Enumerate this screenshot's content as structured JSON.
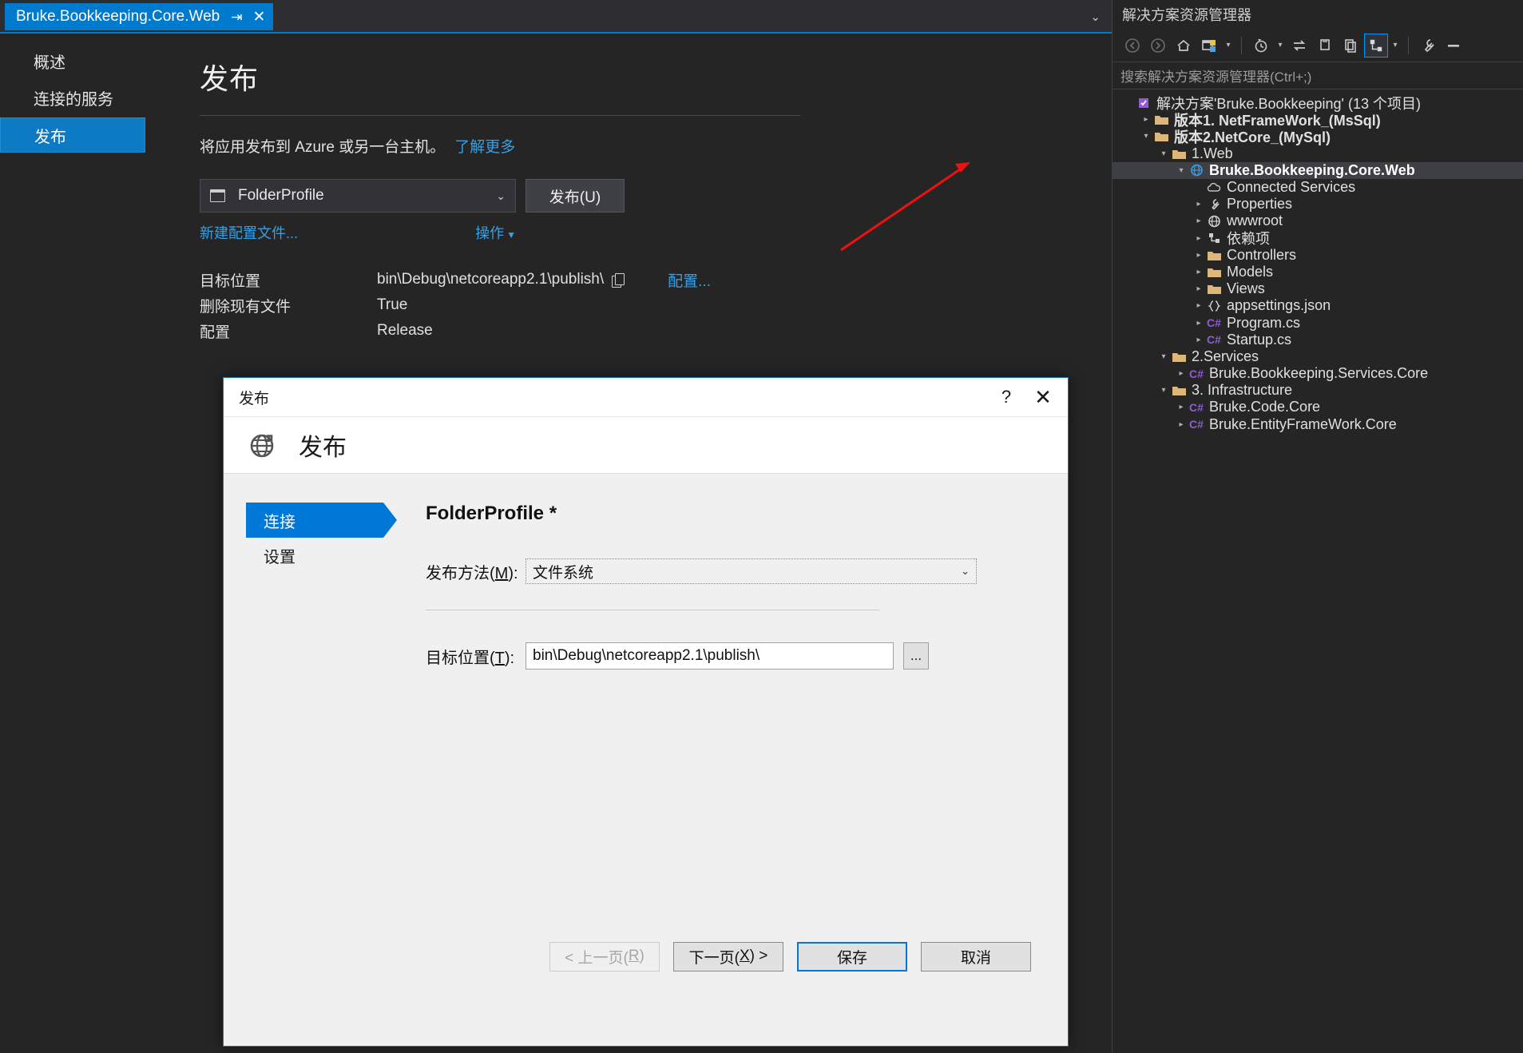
{
  "tab": {
    "title": "Bruke.Bookkeeping.Core.Web",
    "pin_icon": "⇥",
    "close_icon": "✕",
    "overflow_icon": "⌄"
  },
  "leftnav": {
    "items": [
      {
        "label": "概述",
        "selected": false
      },
      {
        "label": "连接的服务",
        "selected": false
      },
      {
        "label": "发布",
        "selected": true
      }
    ]
  },
  "publish_page": {
    "title": "发布",
    "description": "将应用发布到 Azure 或另一台主机。",
    "learn_more": "了解更多",
    "profile_name": "FolderProfile",
    "profile_caret": "⌄",
    "publish_button": "发布(U)",
    "new_profile_link": "新建配置文件...",
    "actions_link": "操作",
    "actions_caret": "▼",
    "details": [
      {
        "key": "目标位置",
        "value": "bin\\Debug\\netcoreapp2.1\\publish\\",
        "has_copy": true,
        "action": "配置..."
      },
      {
        "key": "删除现有文件",
        "value": "True",
        "has_copy": false,
        "action": ""
      },
      {
        "key": "配置",
        "value": "Release",
        "has_copy": false,
        "action": ""
      }
    ]
  },
  "dialog": {
    "titlebar_title": "发布",
    "help_icon": "?",
    "close_icon": "✕",
    "header_title": "发布",
    "header_icon": "globe-publish-icon",
    "nav": [
      {
        "label": "连接",
        "active": true
      },
      {
        "label": "设置",
        "active": false
      }
    ],
    "profile_title": "FolderProfile *",
    "method_label_pre": "发布方法(",
    "method_label_key": "M",
    "method_label_post": "):",
    "method_value": "文件系统",
    "method_caret": "⌄",
    "target_label_pre": "目标位置(",
    "target_label_key": "T",
    "target_label_post": "):",
    "target_value": "bin\\Debug\\netcoreapp2.1\\publish\\",
    "browse_label": "...",
    "buttons": {
      "prev_pre": "< 上一页(",
      "prev_key": "R",
      "prev_post": ")",
      "next_pre": "下一页(",
      "next_key": "X",
      "next_post": ") >",
      "save": "保存",
      "cancel": "取消"
    }
  },
  "solution_explorer": {
    "title": "解决方案资源管理器",
    "search_placeholder": "搜索解决方案资源管理器(Ctrl+;)",
    "toolbar": [
      {
        "name": "back-icon",
        "glyph": "◄",
        "dim": true
      },
      {
        "name": "forward-icon",
        "glyph": "►",
        "dim": true
      },
      {
        "name": "home-icon",
        "glyph": "⌂",
        "dim": false
      },
      {
        "name": "solution-views-icon",
        "glyph": "▤",
        "dim": false
      },
      {
        "name": "pending-changes-icon",
        "glyph": "◷",
        "dim": false
      },
      {
        "name": "sync-with-active-document-icon",
        "glyph": "⇆",
        "dim": false
      },
      {
        "name": "refresh-icon",
        "glyph": "❐",
        "dim": false
      },
      {
        "name": "collapse-all-icon",
        "glyph": "❏",
        "dim": false
      },
      {
        "name": "show-all-files-icon",
        "glyph": "⊿",
        "dim": false
      },
      {
        "name": "properties-icon",
        "glyph": "🔧",
        "dim": false
      },
      {
        "name": "preview-selected-items-icon",
        "glyph": "▬",
        "dim": false
      }
    ],
    "tree": [
      {
        "indent": 0,
        "expander": "",
        "icon": "solution",
        "label": "解决方案'Bruke.Bookkeeping' (13 个项目)",
        "bold": false,
        "selected": false
      },
      {
        "indent": 1,
        "expander": "▷",
        "icon": "folder",
        "label": "版本1. NetFrameWork_(MsSql)",
        "bold": true,
        "selected": false
      },
      {
        "indent": 1,
        "expander": "◢",
        "icon": "folder",
        "label": "版本2.NetCore_(MySql)",
        "bold": true,
        "selected": false
      },
      {
        "indent": 2,
        "expander": "◢",
        "icon": "folder",
        "label": "1.Web",
        "bold": false,
        "selected": false
      },
      {
        "indent": 3,
        "expander": "◢",
        "icon": "web",
        "label": "Bruke.Bookkeeping.Core.Web",
        "bold": true,
        "selected": true
      },
      {
        "indent": 4,
        "expander": "",
        "icon": "cloud",
        "label": "Connected Services",
        "bold": false,
        "selected": false
      },
      {
        "indent": 4,
        "expander": "▷",
        "icon": "wrench",
        "label": "Properties",
        "bold": false,
        "selected": false
      },
      {
        "indent": 4,
        "expander": "▷",
        "icon": "globe",
        "label": "wwwroot",
        "bold": false,
        "selected": false
      },
      {
        "indent": 4,
        "expander": "▷",
        "icon": "deps",
        "label": "依赖项",
        "bold": false,
        "selected": false
      },
      {
        "indent": 4,
        "expander": "▷",
        "icon": "folder",
        "label": "Controllers",
        "bold": false,
        "selected": false
      },
      {
        "indent": 4,
        "expander": "▷",
        "icon": "folder",
        "label": "Models",
        "bold": false,
        "selected": false
      },
      {
        "indent": 4,
        "expander": "▷",
        "icon": "folder",
        "label": "Views",
        "bold": false,
        "selected": false
      },
      {
        "indent": 4,
        "expander": "▷",
        "icon": "json",
        "label": "appsettings.json",
        "bold": false,
        "selected": false
      },
      {
        "indent": 4,
        "expander": "▷",
        "icon": "cs",
        "label": "Program.cs",
        "bold": false,
        "selected": false
      },
      {
        "indent": 4,
        "expander": "▷",
        "icon": "cs",
        "label": "Startup.cs",
        "bold": false,
        "selected": false
      },
      {
        "indent": 2,
        "expander": "◢",
        "icon": "folder",
        "label": "2.Services",
        "bold": false,
        "selected": false
      },
      {
        "indent": 3,
        "expander": "▷",
        "icon": "cs",
        "label": "Bruke.Bookkeeping.Services.Core",
        "bold": false,
        "selected": false
      },
      {
        "indent": 2,
        "expander": "◢",
        "icon": "folder",
        "label": "3. Infrastructure",
        "bold": false,
        "selected": false
      },
      {
        "indent": 3,
        "expander": "▷",
        "icon": "cs",
        "label": "Bruke.Code.Core",
        "bold": false,
        "selected": false
      },
      {
        "indent": 3,
        "expander": "▷",
        "icon": "cs",
        "label": "Bruke.EntityFrameWork.Core",
        "bold": false,
        "selected": false
      }
    ]
  },
  "annotation": {
    "arrow_color": "#ee1111"
  },
  "colors": {
    "accent_blue": "#007acc",
    "dialog_blue": "#0078d7",
    "link_blue": "#3a9fe0",
    "dark_bg": "#252526",
    "dialog_bg": "#f0f0f0"
  }
}
